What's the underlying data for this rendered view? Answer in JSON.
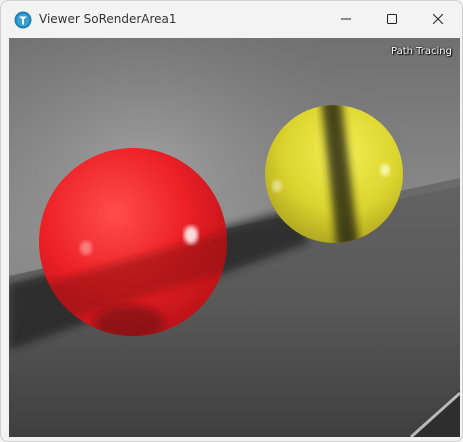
{
  "window": {
    "title": "Viewer SoRenderArea1",
    "app_icon": "coin3d-viewer-icon"
  },
  "caption_buttons": {
    "minimize_icon": "minimize-icon",
    "maximize_icon": "maximize-icon",
    "close_icon": "close-icon"
  },
  "render_area": {
    "render_mode_label": "Path Tracing",
    "colors": {
      "red_sphere": "#e8191c",
      "yellow_sphere": "#e2dc2c",
      "floor": "#5a5a5a",
      "background": "#8a8a8a"
    }
  }
}
